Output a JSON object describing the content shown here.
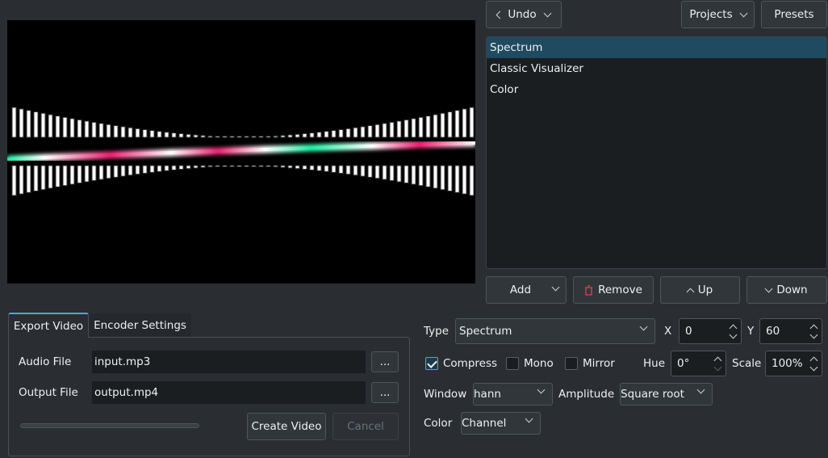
{
  "toolbar": {
    "undo": "Undo",
    "projects": "Projects",
    "presets": "Presets"
  },
  "layers": {
    "items": [
      {
        "label": "Spectrum",
        "selected": true
      },
      {
        "label": "Classic Visualizer"
      },
      {
        "label": "Color"
      }
    ]
  },
  "layer_actions": {
    "add": "Add",
    "remove": "Remove",
    "up": "Up",
    "down": "Down"
  },
  "export": {
    "tabs": [
      "Export Video",
      "Encoder Settings"
    ],
    "audio_label": "Audio File",
    "audio_value": "input.mp3",
    "output_label": "Output File",
    "output_value": "output.mp4",
    "browse": "...",
    "progress": 0,
    "create": "Create Video",
    "cancel": "Cancel"
  },
  "settings": {
    "type_label": "Type",
    "type_value": "Spectrum",
    "x_label": "X",
    "x_value": "0",
    "y_label": "Y",
    "y_value": "60",
    "compress": "Compress",
    "compress_checked": true,
    "mono": "Mono",
    "mono_checked": false,
    "mirror": "Mirror",
    "mirror_checked": false,
    "hue_label": "Hue",
    "hue_value": "0°",
    "scale_label": "Scale",
    "scale_value": "100%",
    "window_label": "Window",
    "window_value": "hann",
    "amplitude_label": "Amplitude",
    "amplitude_value": "Square root",
    "color_label": "Color",
    "color_value": "Channel"
  },
  "colors": {
    "accent": "#3daee9",
    "selection": "#1f4a60",
    "remove_icon": "#da4453",
    "wave_pink": "#e8206f",
    "wave_green": "#1de9a0"
  }
}
